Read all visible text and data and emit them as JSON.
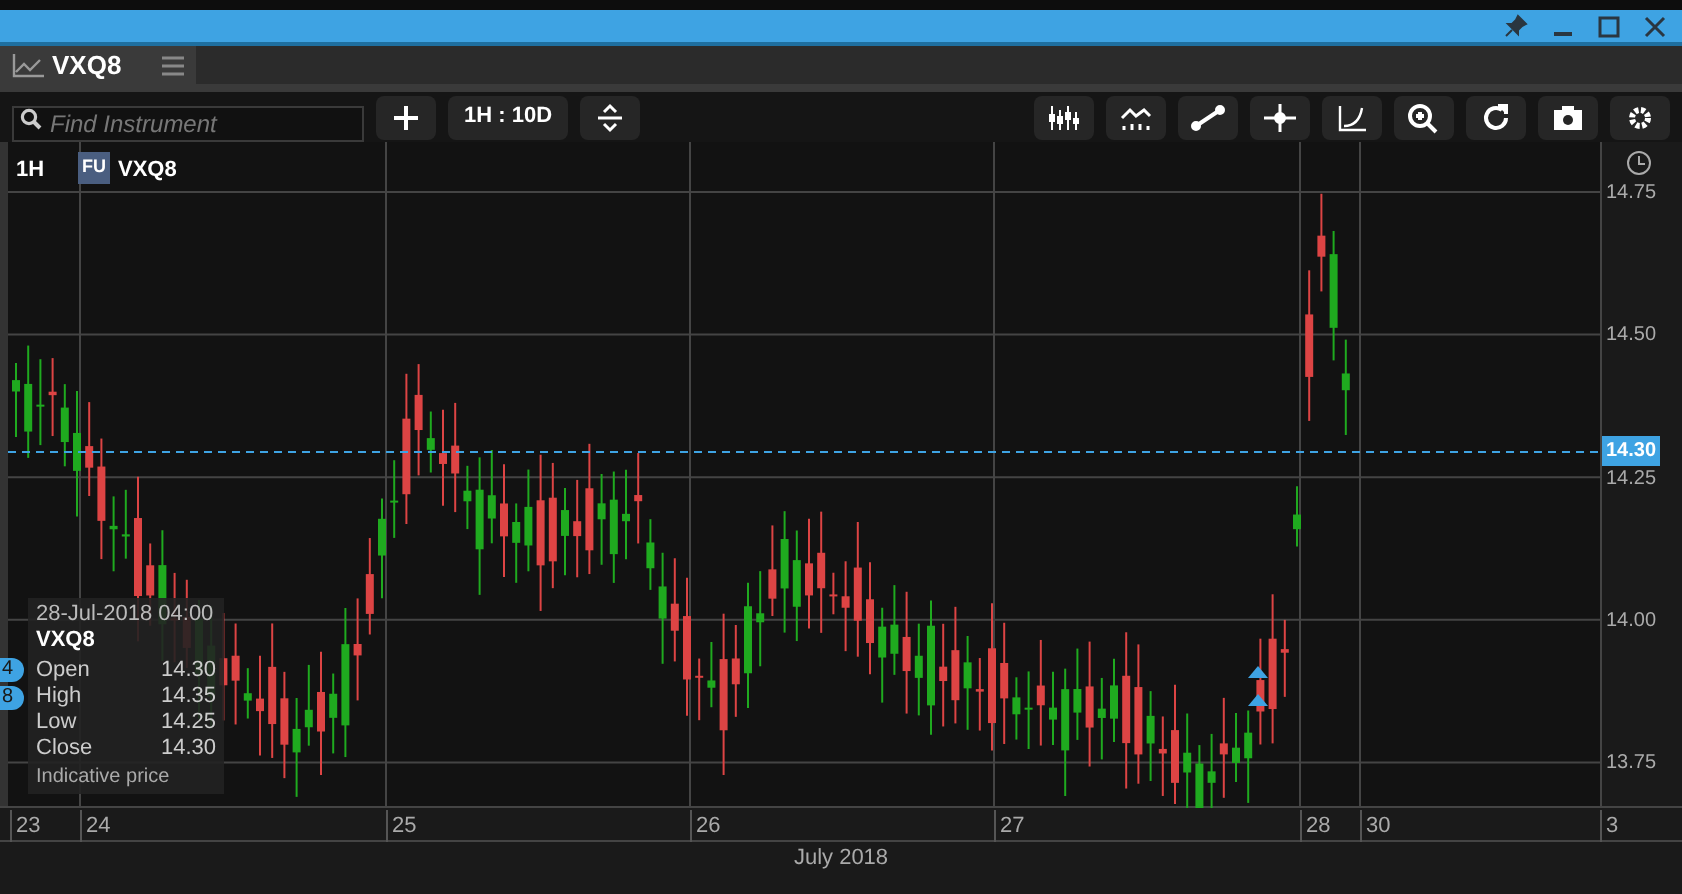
{
  "tab": {
    "label": "VXQ8",
    "selected": true
  },
  "search": {
    "placeholder": "Find Instrument"
  },
  "period_button": "1H : 10D",
  "legend": {
    "interval": "1H",
    "badge": "FU",
    "symbol": "VXQ8"
  },
  "y_axis": [
    "14.75",
    "14.50",
    "14.25",
    "14.00",
    "13.75"
  ],
  "current_price": "14.30",
  "x_axis": [
    "23",
    "24",
    "25",
    "26",
    "27",
    "28",
    "30",
    "3"
  ],
  "month": "July 2018",
  "side_markers": [
    "4",
    "8"
  ],
  "tooltip": {
    "date": "28-Jul-2018 04:00",
    "symbol": "VXQ8",
    "rows": [
      {
        "label": "Open",
        "value": "14.30"
      },
      {
        "label": "High",
        "value": "14.35"
      },
      {
        "label": "Low",
        "value": "14.25"
      },
      {
        "label": "Close",
        "value": "14.30"
      }
    ],
    "note": "Indicative price"
  }
}
